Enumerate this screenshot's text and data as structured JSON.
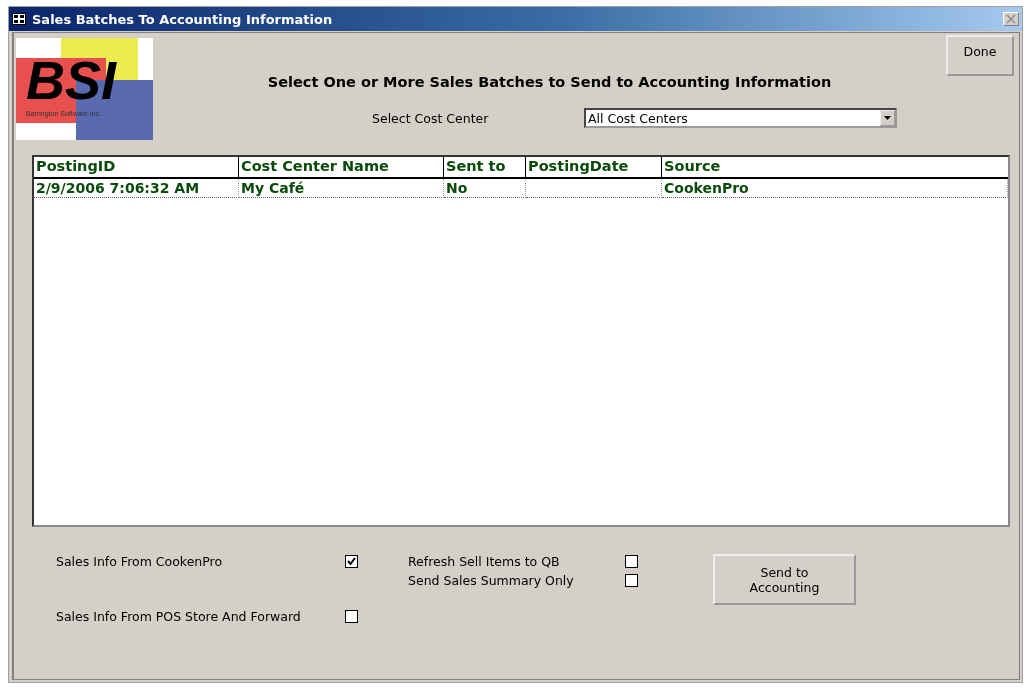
{
  "window": {
    "title": "Sales Batches To Accounting Information"
  },
  "logo": {
    "text": "BSI",
    "subtitle": "Barrington Software Inc."
  },
  "heading": "Select One or More Sales Batches to Send to Accounting Information",
  "done_button": "Done",
  "cost_center": {
    "label": "Select Cost Center",
    "value": "All Cost Centers"
  },
  "table": {
    "columns": [
      "PostingID",
      "Cost Center Name",
      "Sent to",
      "PostingDate",
      "Source"
    ],
    "rows": [
      {
        "cells": [
          "2/9/2006 7:06:32 AM",
          "My Café",
          "No",
          "",
          "CookenPro"
        ],
        "selected": false
      }
    ]
  },
  "source_options": [
    {
      "label": "Sales Info From CookenPro",
      "checked": true
    },
    {
      "label": "Sales Info From POS Store And Forward",
      "checked": false
    }
  ],
  "send_options": [
    {
      "label": "Refresh Sell Items to QB",
      "checked": false
    },
    {
      "label": "Send Sales Summary Only",
      "checked": false
    }
  ],
  "send_button": "Send to Accounting"
}
